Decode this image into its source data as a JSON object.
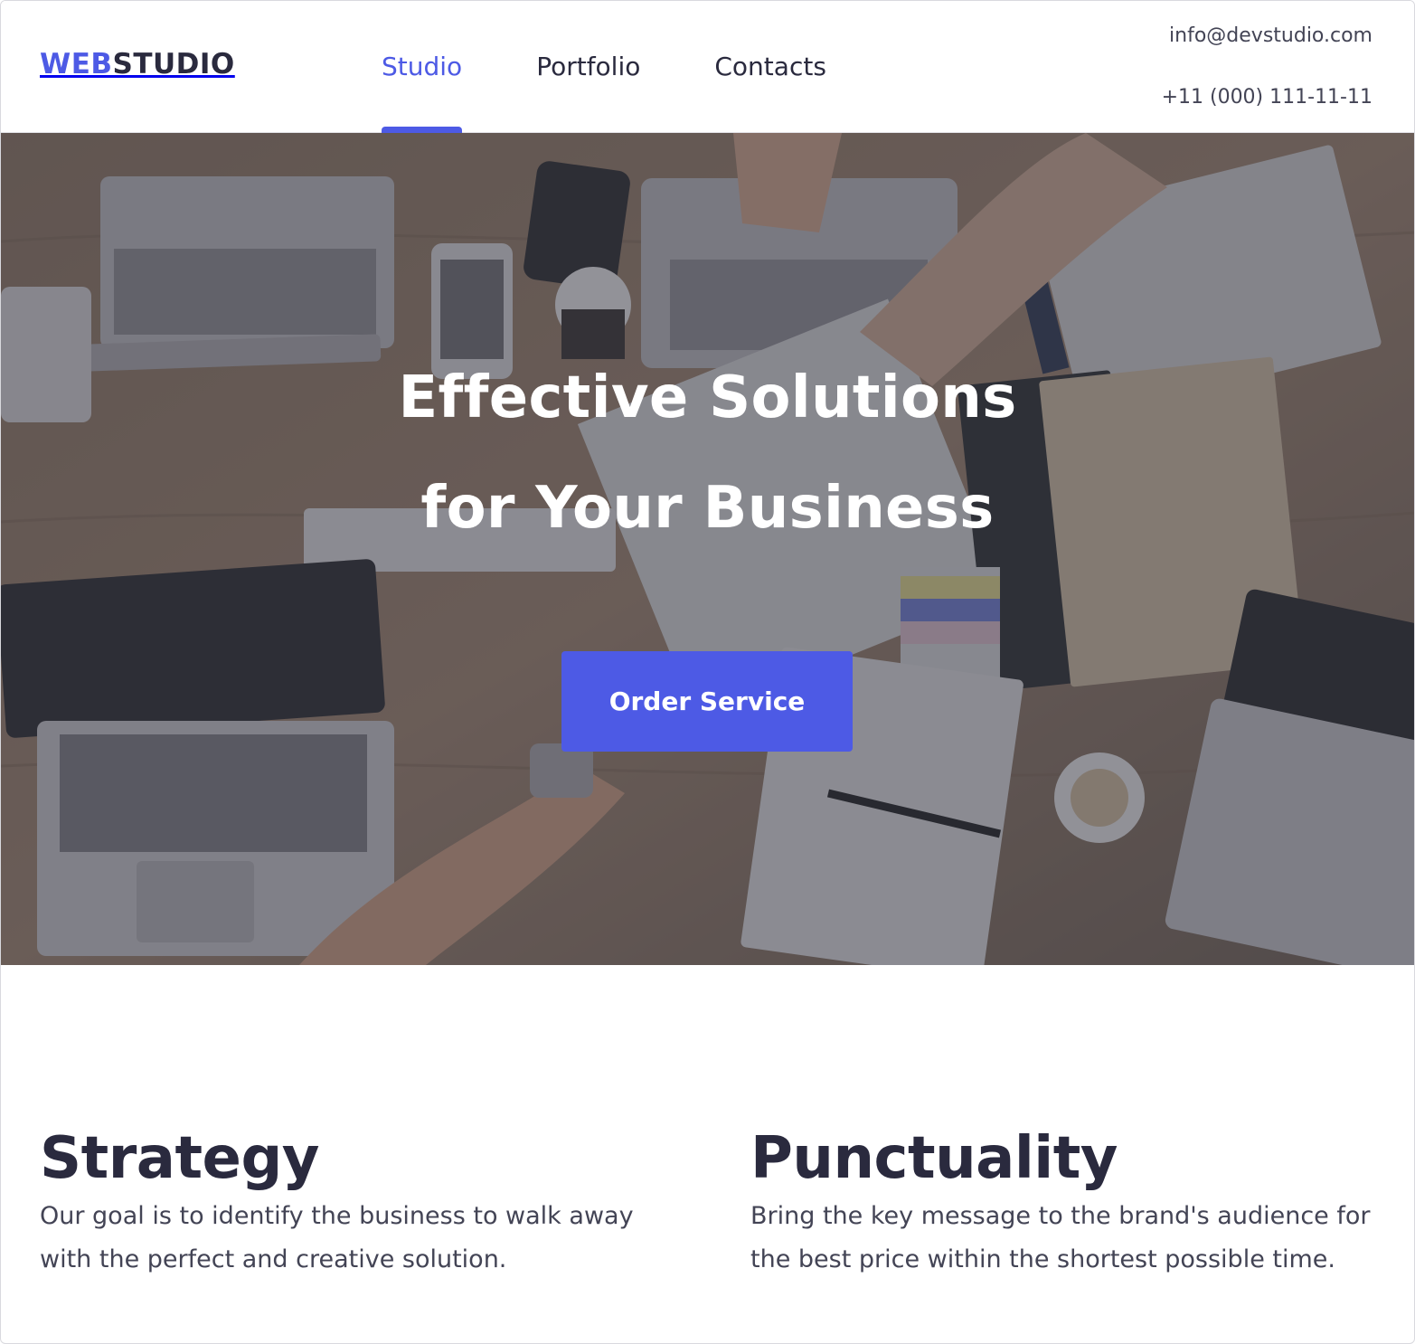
{
  "header": {
    "logo_accent": "WEB",
    "logo_main": "STUDIO",
    "nav": [
      {
        "label": "Studio",
        "active": true
      },
      {
        "label": "Portfolio",
        "active": false
      },
      {
        "label": "Contacts",
        "active": false
      }
    ],
    "email": "info@devstudio.com",
    "phone": "+11 (000) 111-11-11"
  },
  "hero": {
    "title_line1": "Effective Solutions",
    "title_line2": "for Your Business",
    "button_label": "Order Service",
    "background_image": "overhead-view-of-team-desk-with-laptops-icon"
  },
  "features": [
    {
      "title": "Strategy",
      "text": "Our goal is to identify the business to walk away with the perfect and creative solution."
    },
    {
      "title": "Punctuality",
      "text": "Bring the key message to the brand's audience for the best price within the shortest possible time."
    }
  ],
  "colors": {
    "accent": "#4d5ae5",
    "text_dark": "#2a2a3e",
    "text_muted": "#434455"
  }
}
